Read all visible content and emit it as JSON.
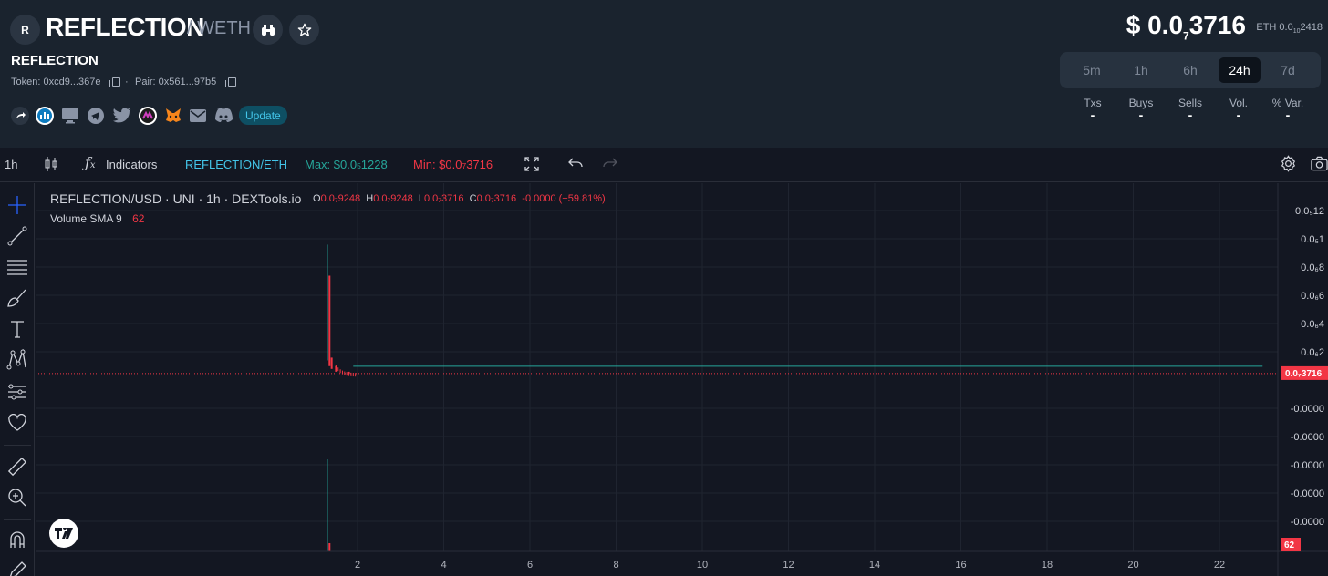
{
  "header": {
    "avatar_letter": "R",
    "token_name": "REFLECTION",
    "pair_suffix": "/ WETH",
    "subtitle": "REFLECTION",
    "token_label": "Token: 0xcd9...367e",
    "pair_label": "Pair: 0x561...97b5",
    "separator": "·",
    "update_label": "Update",
    "social_icons": [
      "share-icon",
      "dextools-icon",
      "website-icon",
      "telegram-icon",
      "twitter-icon",
      "coin-icon",
      "metamask-icon",
      "email-icon",
      "discord-icon"
    ]
  },
  "price": {
    "prefix": "$ 0.0",
    "sub_zeros": "7",
    "digits": "3716",
    "eth_prefix": "ETH 0.0",
    "eth_sub": "10",
    "eth_digits": "2418"
  },
  "timeframes": {
    "options": [
      "5m",
      "1h",
      "6h",
      "24h",
      "7d"
    ],
    "selected": "24h"
  },
  "stats": {
    "headers": [
      "Txs",
      "Buys",
      "Sells",
      "Vol.",
      "% Var."
    ],
    "values": [
      "-",
      "-",
      "-",
      "-",
      "-"
    ]
  },
  "toolbar": {
    "interval": "1h",
    "indicators_label": "Indicators",
    "symbol": "REFLECTION/ETH",
    "max_label": "Max: $0.0",
    "max_sub": "5",
    "max_digits": "1228",
    "min_label": "Min: $0.0",
    "min_sub": "7",
    "min_digits": "3716"
  },
  "legend": {
    "title": "REFLECTION/USD · UNI · 1h · DEXTools.io",
    "o_key": "O",
    "o_val": "0.0₇9248",
    "h_key": "H",
    "h_val": "0.0₇9248",
    "l_key": "L",
    "l_val": "0.0₇3716",
    "c_key": "C",
    "c_val": "0.0₇3716",
    "change": "-0.0000 (−59.81%)",
    "volume_label": "Volume SMA 9",
    "volume_value": "62"
  },
  "colors": {
    "up": "#26a69a",
    "down": "#f23645",
    "accent": "#43c6ea",
    "header_bg": "#1a232e",
    "chart_bg": "#131722"
  },
  "chart_data": {
    "type": "candlestick",
    "title": "REFLECTION/USD · UNI · 1h · DEXTools.io",
    "x_ticks": [
      "2",
      "4",
      "6",
      "8",
      "10",
      "12",
      "14",
      "16",
      "18",
      "20",
      "22"
    ],
    "y_ticks": [
      "0.0₅12",
      "0.0₅1",
      "0.0₆8",
      "0.0₆6",
      "0.0₆4",
      "0.0₆2",
      "-0.0000",
      "-0.0000",
      "-0.0000",
      "-0.0000",
      "-0.0000"
    ],
    "last_price_label": "0.0₇3716",
    "volume_label": "62",
    "y_values_1e-6": [
      12,
      10,
      8,
      6,
      4,
      2
    ],
    "series": [
      {
        "x": 1.3,
        "high": 9.2,
        "low": 1.0,
        "type": "up"
      },
      {
        "x": 1.35,
        "high": 7.0,
        "low": 0.6,
        "type": "down"
      },
      {
        "x": 1.4,
        "high": 1.2,
        "low": 0.4,
        "type": "down"
      },
      {
        "x": 1.5,
        "high": 0.6,
        "low": 0.2,
        "type": "down"
      },
      {
        "x": 1.8,
        "high": 0.2,
        "low": 0.05,
        "type": "down"
      },
      {
        "x": 23.0,
        "high": 0.05,
        "low": 0.04,
        "type": "down"
      }
    ],
    "flat_level": 0.07,
    "grid": true
  }
}
